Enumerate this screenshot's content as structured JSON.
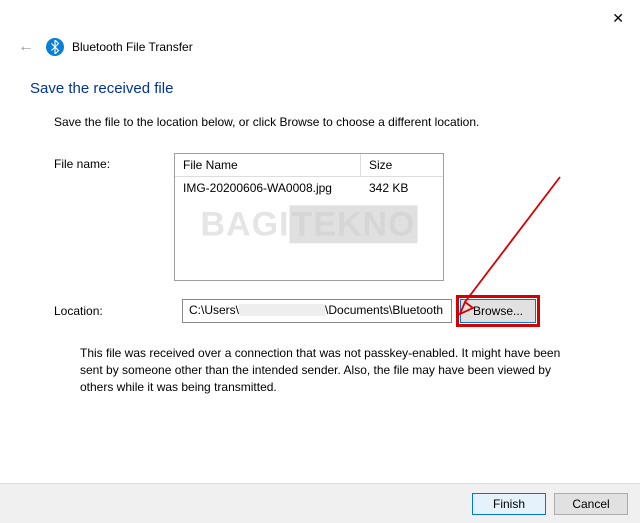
{
  "window": {
    "title": "Bluetooth File Transfer"
  },
  "heading": "Save the received file",
  "instruction": "Save the file to the location below, or click Browse to choose a different location.",
  "labels": {
    "file_name": "File name:",
    "location": "Location:"
  },
  "file_table": {
    "headers": {
      "name": "File Name",
      "size": "Size"
    },
    "row": {
      "name": "IMG-20200606-WA0008.jpg",
      "size": "342 KB"
    }
  },
  "location": {
    "prefix": "C:\\Users\\",
    "suffix": "\\Documents\\Bluetooth"
  },
  "buttons": {
    "browse": "Browse...",
    "finish": "Finish",
    "cancel": "Cancel"
  },
  "warning": "This file was received over a connection that was not passkey-enabled. It might have been sent by someone other than the intended sender. Also, the file may have been viewed by others while it was being transmitted.",
  "watermark": {
    "part1": "BAGI",
    "part2": "TEKNO"
  }
}
